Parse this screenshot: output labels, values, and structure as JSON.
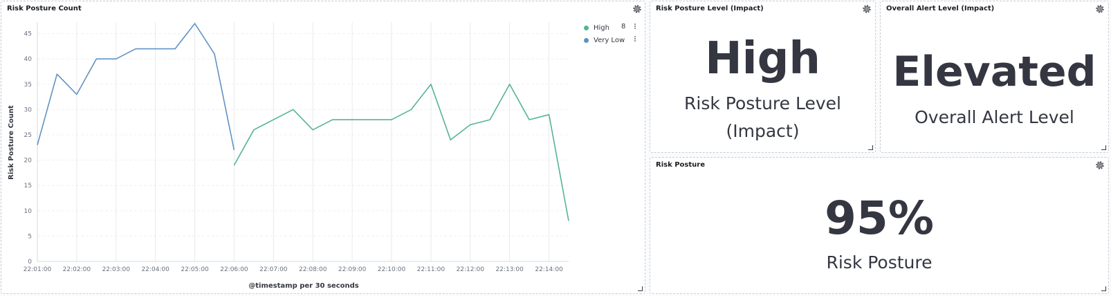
{
  "panels": {
    "chart": {
      "title": "Risk Posture Count"
    },
    "level": {
      "title": "Risk Posture Level (Impact)",
      "value": "High",
      "label_line1": "Risk Posture Level",
      "label_line2": "(Impact)"
    },
    "alert": {
      "title": "Overall Alert Level (Impact)",
      "value": "Elevated",
      "label": "Overall Alert Level"
    },
    "posture": {
      "title": "Risk Posture",
      "value": "95%",
      "label": "Risk Posture"
    }
  },
  "icons": {
    "panel_options": "gear-icon",
    "resize": "resize-handle-icon",
    "legend_options": "vertical-dots-icon"
  },
  "chart_data": {
    "type": "line",
    "title": "Risk Posture Count",
    "xlabel": "@timestamp per 30 seconds",
    "ylabel": "Risk Posture Count",
    "ylim": [
      0,
      47
    ],
    "yticks": [
      0,
      5,
      10,
      15,
      20,
      25,
      30,
      35,
      40,
      45
    ],
    "x_tick_labels": [
      "22:01:00",
      "22:02:00",
      "22:03:00",
      "22:04:00",
      "22:05:00",
      "22:06:00",
      "22:07:00",
      "22:08:00",
      "22:09:00",
      "22:10:00",
      "22:11:00",
      "22:12:00",
      "22:13:00",
      "22:14:00"
    ],
    "x": [
      "22:01:00",
      "22:01:30",
      "22:02:00",
      "22:02:30",
      "22:03:00",
      "22:03:30",
      "22:04:00",
      "22:04:30",
      "22:05:00",
      "22:05:30",
      "22:06:00",
      "22:06:30",
      "22:07:00",
      "22:07:30",
      "22:08:00",
      "22:08:30",
      "22:09:00",
      "22:09:30",
      "22:10:00",
      "22:10:30",
      "22:11:00",
      "22:11:30",
      "22:12:00",
      "22:12:30",
      "22:13:00",
      "22:13:30",
      "22:14:00",
      "22:14:30"
    ],
    "grid": true,
    "legend_position": "top-right",
    "series": [
      {
        "name": "High",
        "color": "#54b399",
        "legend_value": "8",
        "values": [
          null,
          null,
          null,
          null,
          null,
          null,
          null,
          null,
          null,
          null,
          19,
          26,
          28,
          30,
          26,
          28,
          28,
          28,
          28,
          30,
          35,
          24,
          27,
          28,
          35,
          28,
          29,
          8
        ]
      },
      {
        "name": "Very Low",
        "color": "#6092c0",
        "legend_value": "",
        "values": [
          23,
          37,
          33,
          40,
          40,
          42,
          42,
          42,
          47,
          41,
          22,
          null,
          null,
          null,
          null,
          null,
          null,
          null,
          null,
          null,
          null,
          null,
          null,
          null,
          null,
          null,
          null,
          null
        ]
      }
    ]
  }
}
